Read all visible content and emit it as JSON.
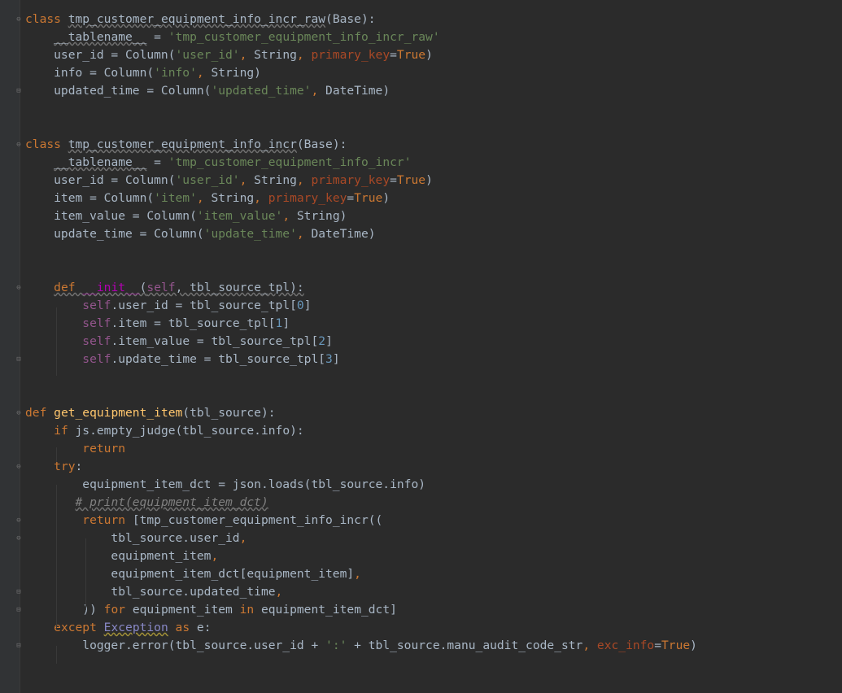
{
  "lines": [
    {
      "fold": "open",
      "parts": [
        [
          "kw",
          "class "
        ],
        [
          "cls",
          "tmp_customer_equipment_info_incr_raw"
        ],
        [
          "p",
          "(Base):"
        ]
      ]
    },
    {
      "fold": "",
      "parts": [
        [
          "p",
          "    "
        ],
        [
          "ul",
          "__tablename__"
        ],
        [
          "p",
          " = "
        ],
        [
          "str",
          "'tmp_customer_equipment_info_incr_raw'"
        ]
      ]
    },
    {
      "fold": "",
      "parts": [
        [
          "p",
          "    user_id = Column("
        ],
        [
          "str",
          "'user_id'"
        ],
        [
          "kw",
          ", "
        ],
        [
          "p",
          "String"
        ],
        [
          "kw",
          ", "
        ],
        [
          "param",
          "primary_key"
        ],
        [
          "p",
          "="
        ],
        [
          "kw",
          "True"
        ],
        [
          "p",
          ")"
        ]
      ]
    },
    {
      "fold": "",
      "parts": [
        [
          "p",
          "    info = Column("
        ],
        [
          "str",
          "'info'"
        ],
        [
          "kw",
          ", "
        ],
        [
          "p",
          "String)"
        ]
      ]
    },
    {
      "fold": "close",
      "parts": [
        [
          "p",
          "    updated_time = Column("
        ],
        [
          "str",
          "'updated_time'"
        ],
        [
          "kw",
          ", "
        ],
        [
          "p",
          "DateTime)"
        ]
      ]
    },
    {
      "fold": "",
      "parts": []
    },
    {
      "fold": "",
      "parts": []
    },
    {
      "fold": "open",
      "parts": [
        [
          "kw",
          "class "
        ],
        [
          "cls",
          "tmp_customer_equipment_info_incr"
        ],
        [
          "p",
          "(Base):"
        ]
      ]
    },
    {
      "fold": "",
      "parts": [
        [
          "p",
          "    "
        ],
        [
          "ul",
          "__tablename__"
        ],
        [
          "p",
          " = "
        ],
        [
          "str",
          "'tmp_customer_equipment_info_incr'"
        ]
      ]
    },
    {
      "fold": "",
      "parts": [
        [
          "p",
          "    user_id = Column("
        ],
        [
          "str",
          "'user_id'"
        ],
        [
          "kw",
          ", "
        ],
        [
          "p",
          "String"
        ],
        [
          "kw",
          ", "
        ],
        [
          "param",
          "primary_key"
        ],
        [
          "p",
          "="
        ],
        [
          "kw",
          "True"
        ],
        [
          "p",
          ")"
        ]
      ]
    },
    {
      "fold": "",
      "parts": [
        [
          "p",
          "    item = Column("
        ],
        [
          "str",
          "'item'"
        ],
        [
          "kw",
          ", "
        ],
        [
          "p",
          "String"
        ],
        [
          "kw",
          ", "
        ],
        [
          "param",
          "primary_key"
        ],
        [
          "p",
          "="
        ],
        [
          "kw",
          "True"
        ],
        [
          "p",
          ")"
        ]
      ]
    },
    {
      "fold": "",
      "parts": [
        [
          "p",
          "    item_value = Column("
        ],
        [
          "str",
          "'item_value'"
        ],
        [
          "kw",
          ", "
        ],
        [
          "p",
          "String)"
        ]
      ]
    },
    {
      "fold": "",
      "parts": [
        [
          "p",
          "    update_time = Column("
        ],
        [
          "str",
          "'update_time'"
        ],
        [
          "kw",
          ", "
        ],
        [
          "p",
          "DateTime)"
        ]
      ]
    },
    {
      "fold": "",
      "parts": []
    },
    {
      "fold": "",
      "parts": []
    },
    {
      "fold": "open",
      "parts": [
        [
          "p",
          "    "
        ],
        [
          "kwul",
          "def "
        ],
        [
          "magic",
          "__init__"
        ],
        [
          "ul",
          "("
        ],
        [
          "selful",
          "self"
        ],
        [
          "ul",
          ", tbl_source_tpl):"
        ]
      ]
    },
    {
      "fold": "",
      "parts": [
        [
          "p",
          "        "
        ],
        [
          "self",
          "self"
        ],
        [
          "p",
          ".user_id = tbl_source_tpl["
        ],
        [
          "num",
          "0"
        ],
        [
          "p",
          "]"
        ]
      ]
    },
    {
      "fold": "",
      "parts": [
        [
          "p",
          "        "
        ],
        [
          "self",
          "self"
        ],
        [
          "p",
          ".item = tbl_source_tpl["
        ],
        [
          "num",
          "1"
        ],
        [
          "p",
          "]"
        ]
      ]
    },
    {
      "fold": "",
      "parts": [
        [
          "p",
          "        "
        ],
        [
          "self",
          "self"
        ],
        [
          "p",
          ".item_value = tbl_source_tpl["
        ],
        [
          "num",
          "2"
        ],
        [
          "p",
          "]"
        ]
      ]
    },
    {
      "fold": "close",
      "parts": [
        [
          "p",
          "        "
        ],
        [
          "self",
          "self"
        ],
        [
          "p",
          ".update_time = tbl_source_tpl["
        ],
        [
          "num",
          "3"
        ],
        [
          "p",
          "]"
        ]
      ]
    },
    {
      "fold": "",
      "parts": []
    },
    {
      "fold": "",
      "parts": []
    },
    {
      "fold": "open",
      "parts": [
        [
          "kw",
          "def "
        ],
        [
          "fn",
          "get_equipment_item"
        ],
        [
          "p",
          "(tbl_source):"
        ]
      ]
    },
    {
      "fold": "",
      "parts": [
        [
          "p",
          "    "
        ],
        [
          "kw",
          "if "
        ],
        [
          "p",
          "js.empty_judge(tbl_source.info):"
        ]
      ]
    },
    {
      "fold": "",
      "parts": [
        [
          "p",
          "        "
        ],
        [
          "kw",
          "return"
        ]
      ]
    },
    {
      "fold": "open",
      "parts": [
        [
          "p",
          "    "
        ],
        [
          "kw",
          "try"
        ],
        [
          "p",
          ":"
        ]
      ]
    },
    {
      "fold": "",
      "parts": [
        [
          "p",
          "        equipment_item_dct = json.loads(tbl_source.info)"
        ]
      ]
    },
    {
      "fold": "",
      "parts": [
        [
          "p",
          "       "
        ],
        [
          "cmul",
          "# print(equipment_item_dct)"
        ]
      ]
    },
    {
      "fold": "open",
      "parts": [
        [
          "p",
          "        "
        ],
        [
          "kw",
          "return "
        ],
        [
          "p",
          "[tmp_customer_equipment_info_incr(("
        ]
      ]
    },
    {
      "fold": "open",
      "parts": [
        [
          "p",
          "            tbl_source.user_id"
        ],
        [
          "kw",
          ","
        ]
      ]
    },
    {
      "fold": "",
      "parts": [
        [
          "p",
          "            equipment_item"
        ],
        [
          "kw",
          ","
        ]
      ]
    },
    {
      "fold": "",
      "parts": [
        [
          "p",
          "            equipment_item_dct[equipment_item]"
        ],
        [
          "kw",
          ","
        ]
      ]
    },
    {
      "fold": "close",
      "parts": [
        [
          "p",
          "            tbl_source.updated_time"
        ],
        [
          "kw",
          ","
        ]
      ]
    },
    {
      "fold": "close",
      "parts": [
        [
          "p",
          "        )) "
        ],
        [
          "kw",
          "for "
        ],
        [
          "p",
          "equipment_item "
        ],
        [
          "kw",
          "in "
        ],
        [
          "p",
          "equipment_item_dct]"
        ]
      ]
    },
    {
      "fold": "",
      "parts": [
        [
          "p",
          "    "
        ],
        [
          "kw",
          "except "
        ],
        [
          "builtinul",
          "Exception"
        ],
        [
          "kw",
          " as "
        ],
        [
          "p",
          "e:"
        ]
      ]
    },
    {
      "fold": "close",
      "parts": [
        [
          "p",
          "        logger.error(tbl_source.user_id + "
        ],
        [
          "str",
          "':'"
        ],
        [
          "p",
          " + tbl_source.manu_audit_code_str"
        ],
        [
          "kw",
          ", "
        ],
        [
          "param",
          "exc_info"
        ],
        [
          "p",
          "="
        ],
        [
          "kw",
          "True"
        ],
        [
          "p",
          ")"
        ]
      ]
    }
  ]
}
